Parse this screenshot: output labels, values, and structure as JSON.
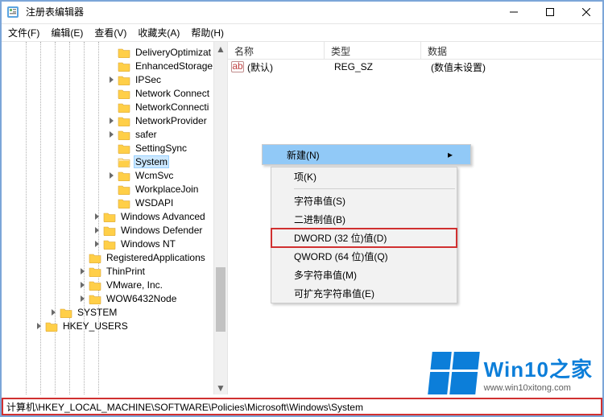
{
  "title": "注册表编辑器",
  "window": {
    "min": "—",
    "max": "▢",
    "close": "✕"
  },
  "menubar": [
    "文件(F)",
    "编辑(E)",
    "查看(V)",
    "收藏夹(A)",
    "帮助(H)"
  ],
  "tree": [
    {
      "ind": 6,
      "exp": "none",
      "label": "DeliveryOptimizat"
    },
    {
      "ind": 6,
      "exp": "none",
      "label": "EnhancedStorage"
    },
    {
      "ind": 6,
      "exp": "closed",
      "label": "IPSec"
    },
    {
      "ind": 6,
      "exp": "none",
      "label": "Network Connect"
    },
    {
      "ind": 6,
      "exp": "none",
      "label": "NetworkConnecti"
    },
    {
      "ind": 6,
      "exp": "closed",
      "label": "NetworkProvider"
    },
    {
      "ind": 6,
      "exp": "closed",
      "label": "safer"
    },
    {
      "ind": 6,
      "exp": "none",
      "label": "SettingSync"
    },
    {
      "ind": 6,
      "exp": "none",
      "label": "System",
      "sel": true
    },
    {
      "ind": 6,
      "exp": "closed",
      "label": "WcmSvc"
    },
    {
      "ind": 6,
      "exp": "none",
      "label": "WorkplaceJoin"
    },
    {
      "ind": 6,
      "exp": "none",
      "label": "WSDAPI"
    },
    {
      "ind": 5,
      "exp": "closed",
      "label": "Windows Advanced "
    },
    {
      "ind": 5,
      "exp": "closed",
      "label": "Windows Defender"
    },
    {
      "ind": 5,
      "exp": "closed",
      "label": "Windows NT"
    },
    {
      "ind": 4,
      "exp": "none",
      "label": "RegisteredApplications"
    },
    {
      "ind": 4,
      "exp": "closed",
      "label": "ThinPrint"
    },
    {
      "ind": 4,
      "exp": "closed",
      "label": "VMware, Inc."
    },
    {
      "ind": 4,
      "exp": "closed",
      "label": "WOW6432Node"
    },
    {
      "ind": 2,
      "exp": "closed",
      "label": "SYSTEM"
    },
    {
      "ind": 1,
      "exp": "closed",
      "label": "HKEY_USERS"
    }
  ],
  "list": {
    "headers": {
      "name": "名称",
      "type": "类型",
      "data": "数据"
    },
    "rows": [
      {
        "name": "(默认)",
        "type": "REG_SZ",
        "data": "(数值未设置)"
      }
    ]
  },
  "ctx1": {
    "new": "新建(N)"
  },
  "ctx2": {
    "key": "项(K)",
    "sz": "字符串值(S)",
    "bin": "二进制值(B)",
    "dword": "DWORD (32 位)值(D)",
    "qword": "QWORD (64 位)值(Q)",
    "multi": "多字符串值(M)",
    "expand": "可扩充字符串值(E)"
  },
  "statusbar": "计算机\\HKEY_LOCAL_MACHINE\\SOFTWARE\\Policies\\Microsoft\\Windows\\System",
  "watermark": {
    "big": "Win10之家",
    "url": "www.win10xitong.com"
  }
}
